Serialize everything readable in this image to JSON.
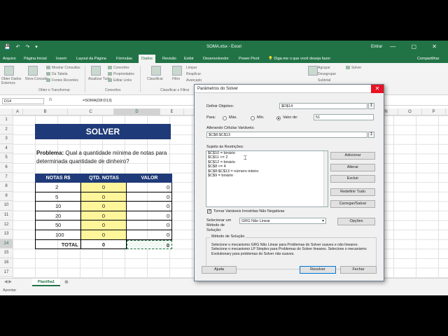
{
  "window": {
    "title": "SOMA.xlsx - Excel",
    "login": "Entrar",
    "qa_icons": "💾 ↶ ↷ ▾",
    "window_controls": "— ▢ ✕"
  },
  "menu": {
    "items": [
      "Arquivo",
      "Página Inicial",
      "Inserir",
      "Layout da Página",
      "Fórmulas",
      "Dados",
      "Revisão",
      "Exibir",
      "Desenvolvedor",
      "Power Pivot"
    ],
    "active": "Dados",
    "tell_me": "Diga-me o que você deseja fazer",
    "share": "Compartilhar"
  },
  "ribbon": {
    "get_external": "Obter Dados Externos",
    "new_query": "Nova Consulta",
    "show_queries": "Mostrar Consultas",
    "from_table": "Da Tabela",
    "recent_sources": "Fontes Recentes",
    "refresh_all": "Atualizar Tudo",
    "connections": "Conexões",
    "properties": "Propriedades",
    "edit_links": "Editar Links",
    "sort": "Classificar",
    "filter": "Filtro",
    "clear": "Limpar",
    "reapply": "Reaplicar",
    "advanced": "Avançado",
    "text_to_columns": "Texto para Colunas",
    "what_if": "Teste de Hipóteses",
    "forecast": "Planilha de Previsão",
    "group": "Agrupar",
    "ungroup": "Desagrupar",
    "subtotal": "Subtotal",
    "solver": "Solver",
    "group_get_transform": "Obter e Transformar",
    "group_connections": "Conexões",
    "group_sort_filter": "Classificar e Filtrar"
  },
  "formula_bar": {
    "name_box": "D14",
    "fx": "fx",
    "formula": "=SOMA(D8:D13)"
  },
  "columns": [
    "A",
    "B",
    "C",
    "D",
    "E",
    "F",
    "G",
    "H",
    "I",
    "J",
    "K",
    "L",
    "M",
    "N",
    "O",
    "P",
    "Q",
    "R",
    "S"
  ],
  "rows": [
    "1",
    "2",
    "3",
    "4",
    "5",
    "6",
    "7",
    "8",
    "9",
    "10",
    "11",
    "12",
    "13",
    "14",
    "15",
    "16",
    "17"
  ],
  "sheet": {
    "banner": "SOLVER",
    "problem_label": "Problema:",
    "problem_text": " Qual a quantidade mínima de notas para determinada quantidade de dinheiro?",
    "headers": [
      "NOTAS R$",
      "QTD. NOTAS",
      "VALOR"
    ],
    "rows": [
      {
        "nota": "2",
        "qtd": "0",
        "valor": "0"
      },
      {
        "nota": "5",
        "qtd": "0",
        "valor": "0"
      },
      {
        "nota": "10",
        "qtd": "0",
        "valor": "0"
      },
      {
        "nota": "20",
        "qtd": "0",
        "valor": "0"
      },
      {
        "nota": "50",
        "qtd": "0",
        "valor": "0"
      },
      {
        "nota": "100",
        "qtd": "0",
        "valor": "0"
      }
    ],
    "total_label": "TOTAL",
    "total_qtd": "0",
    "total_valor": "0",
    "tab_name": "Planilha1",
    "status": "Apontar"
  },
  "solver": {
    "title": "Parâmetros do Solver",
    "objective_label": "Definir Objetivo:",
    "objective_value": "$D$14",
    "to_label": "Para:",
    "opt_max": "Máx.",
    "opt_min": "Mín.",
    "opt_value": "Valor de:",
    "value_of": "51",
    "variable_label": "Alterando Células Variáveis:",
    "variable_value": "$C$8:$C$13",
    "constraints_label": "Sujeito às Restrições:",
    "constraints": [
      "$C$10 = binário",
      "$C$11 <= 2",
      "$C$12 = binário",
      "$C$8 <= 4",
      "$C$8:$C$13 = número inteiro",
      "$C$9 = binário"
    ],
    "btn_add": "Adicionar",
    "btn_change": "Alterar",
    "btn_delete": "Excluir",
    "btn_reset": "Redefinir Tudo",
    "btn_load": "Carregar/Salvar",
    "nonneg_label": "Tornar Variáveis Irrestritas Não Negativas",
    "method_label": "Selecionar um Método de Solução:",
    "method_value": "GRG Não Linear",
    "btn_options": "Opções",
    "method_group": "Método de Solução",
    "method_desc": "Selecione o mecanismo GRG Não Linear para Problemas do Solver suaves e não lineares. Selecione o mecanismo LP Simplex para Problemas do Solver lineares. Selecione o mecanismo Evolutionary para problemas do Solver não suaves.",
    "btn_help": "Ajuda",
    "btn_solve": "Resolver",
    "btn_close": "Fechar"
  }
}
